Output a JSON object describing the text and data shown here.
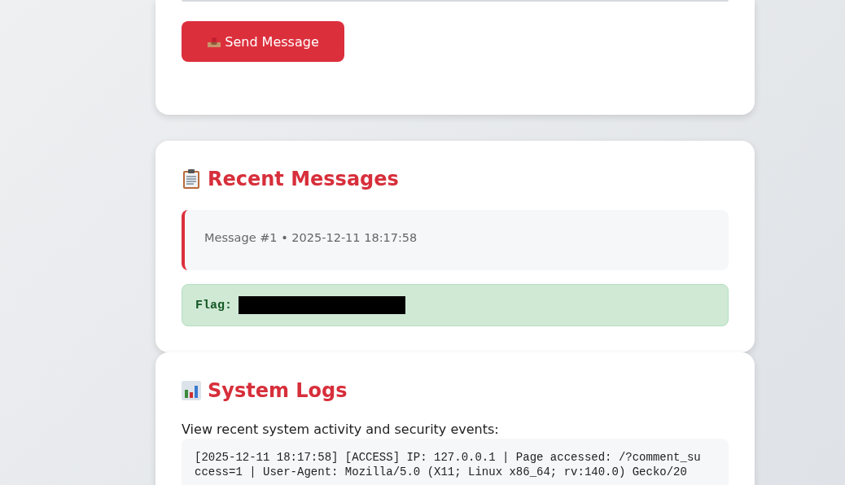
{
  "contact_form": {
    "send_button": "Send Message"
  },
  "recent_messages": {
    "title": "Recent Messages",
    "messages": [
      {
        "meta": "Message #1 • 2025-12-11 18:17:58"
      }
    ],
    "flag": {
      "label": "Flag:",
      "redacted": true
    }
  },
  "system_logs": {
    "title": "System Logs",
    "description": "View recent system activity and security events:",
    "log_lines": [
      "[2025-12-11 18:17:58] [ACCESS] IP: 127.0.0.1 | Page accessed: /?comment_success=1 | User-Agent: Mozilla/5.0 (X11; Linux x86_64; rv:140.0) Gecko/20"
    ]
  }
}
